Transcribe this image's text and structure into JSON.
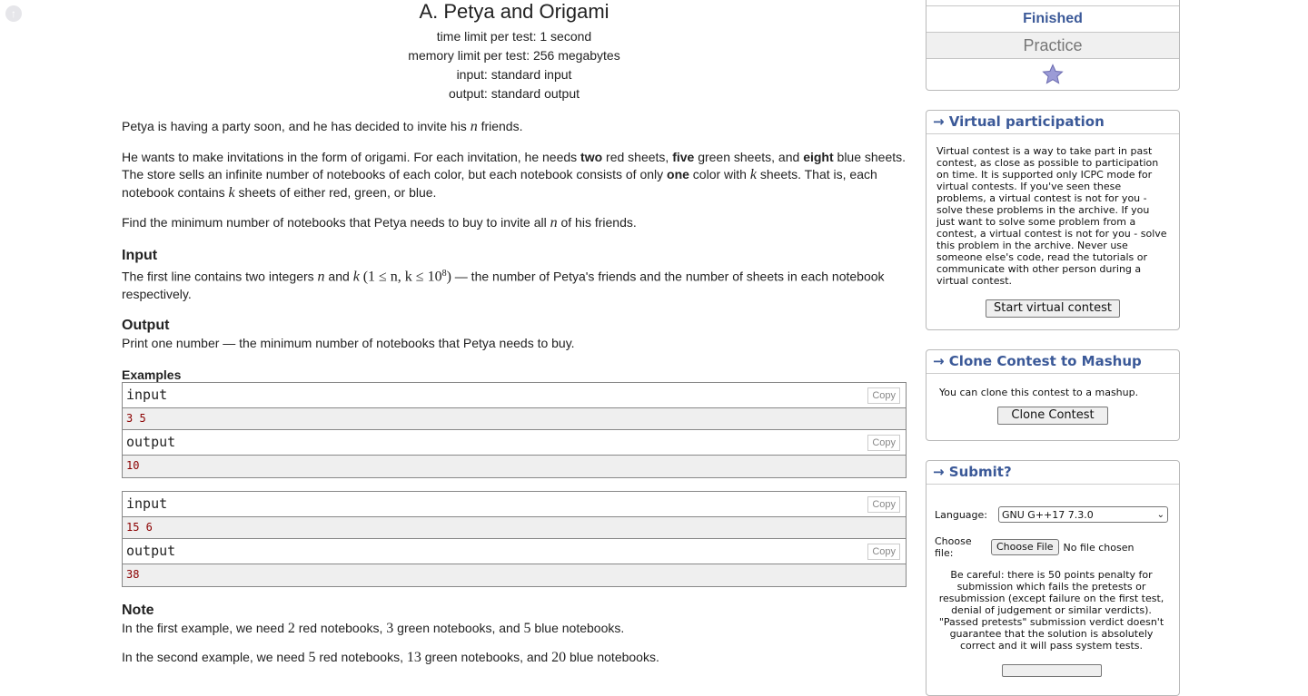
{
  "problem": {
    "title": "A. Petya and Origami",
    "time_limit": "time limit per test: 1 second",
    "memory_limit": "memory limit per test: 256 megabytes",
    "input_file": "input: standard input",
    "output_file": "output: standard output",
    "legend1": {
      "a": "Petya is having a party soon, and he has decided to invite his ",
      "n": "n",
      "b": " friends."
    },
    "legend2": {
      "a": "He wants to make invitations in the form of origami. For each invitation, he needs ",
      "two": "two",
      "b": " red sheets, ",
      "five": "five",
      "c": " green sheets, and ",
      "eight": "eight",
      "d": " blue sheets. The store sells an infinite number of notebooks of each color, but each notebook consists of only ",
      "one": "one",
      "e": " color with ",
      "k": "k",
      "f": " sheets. That is, each notebook contains ",
      "k2": "k",
      "g": " sheets of either red, green, or blue."
    },
    "legend3": {
      "a": "Find the minimum number of notebooks that Petya needs to buy to invite all ",
      "n": "n",
      "b": " of his friends."
    },
    "input_title": "Input",
    "input_text": {
      "a": "The first line contains two integers ",
      "n": "n",
      "b": " and ",
      "k": "k",
      "formula": "(1 ≤ n, k ≤ 10",
      "sup": "8",
      "formula_end": ")",
      "c": " — the number of Petya's friends and the number of sheets in each notebook respectively."
    },
    "output_title": "Output",
    "output_text": "Print one number — the minimum number of notebooks that Petya needs to buy.",
    "examples_title": "Examples",
    "examples": [
      {
        "input_label": "input",
        "input": "3 5",
        "output_label": "output",
        "output": "10"
      },
      {
        "input_label": "input",
        "input": "15 6",
        "output_label": "output",
        "output": "38"
      }
    ],
    "copy_label": "Copy",
    "note_title": "Note",
    "note1": {
      "a": "In the first example, we need ",
      "v1": "2",
      "b": " red notebooks, ",
      "v2": "3",
      "c": " green notebooks, and ",
      "v3": "5",
      "d": " blue notebooks."
    },
    "note2": {
      "a": "In the second example, we need ",
      "v1": "5",
      "b": " red notebooks, ",
      "v2": "13",
      "c": " green notebooks, and ",
      "v3": "20",
      "d": " blue notebooks."
    }
  },
  "sidebar": {
    "status": {
      "finished": "Finished",
      "practice": "Practice"
    },
    "virtual": {
      "title": "→ Virtual participation",
      "text": "Virtual contest is a way to take part in past contest, as close as possible to participation on time. It is supported only ICPC mode for virtual contests. If you've seen these problems, a virtual contest is not for you - solve these problems in the archive. If you just want to solve some problem from a contest, a virtual contest is not for you - solve this problem in the archive. Never use someone else's code, read the tutorials or communicate with other person during a virtual contest.",
      "button": "Start virtual contest"
    },
    "clone": {
      "title": "→ Clone Contest to Mashup",
      "text": "You can clone this contest to a mashup.",
      "button": "Clone Contest"
    },
    "submit": {
      "title": "→ Submit?",
      "language_label": "Language:",
      "language_value": "GNU G++17 7.3.0",
      "file_label": "Choose file:",
      "file_button": "Choose File",
      "file_status": "No file chosen",
      "warning": "Be careful: there is 50 points penalty for submission which fails the pretests or resubmission (except failure on the first test, denial of judgement or similar verdicts). \"Passed pretests\" submission verdict doesn't guarantee that the solution is absolutely correct and it will pass system tests."
    }
  },
  "colors": {
    "accent": "#3b5998",
    "sample_text": "#8b0000",
    "star": "#9b9bd6"
  }
}
